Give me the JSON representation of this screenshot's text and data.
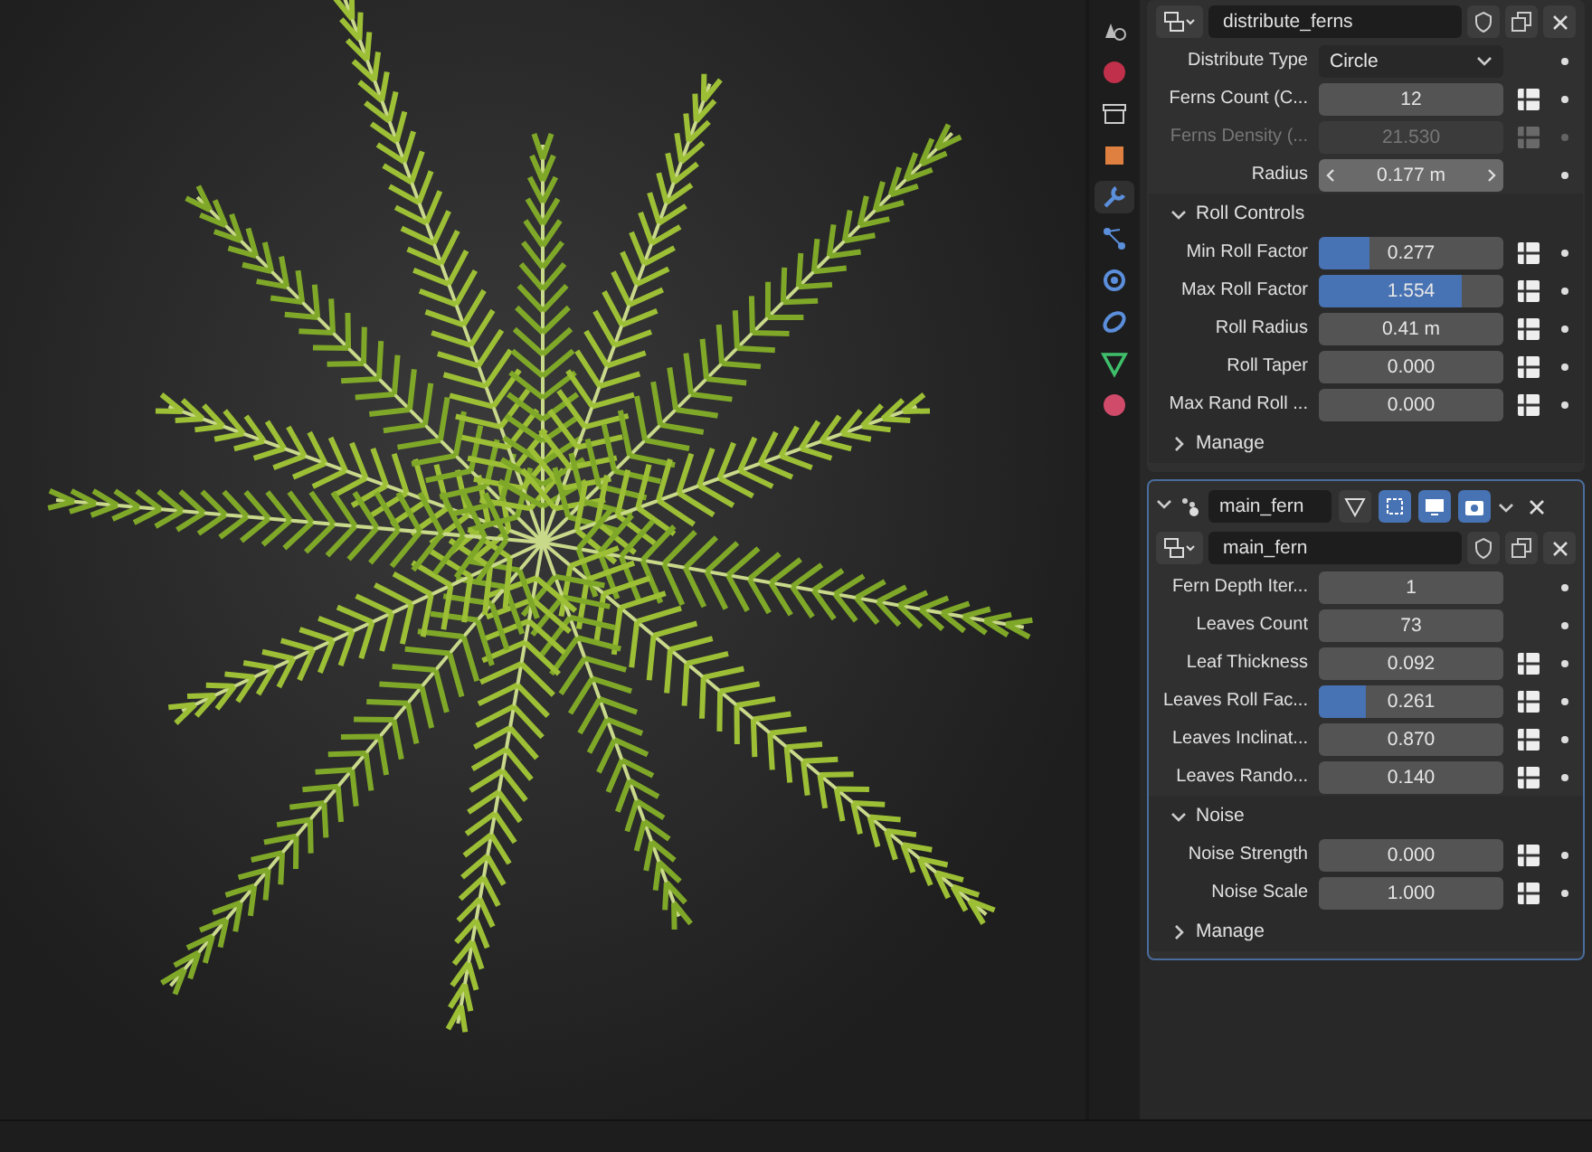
{
  "sidebar_tabs": [
    {
      "kind": "scene",
      "selected": false
    },
    {
      "kind": "world",
      "selected": false
    },
    {
      "kind": "collection",
      "selected": false
    },
    {
      "kind": "object",
      "selected": false
    },
    {
      "kind": "modifiers",
      "selected": true
    },
    {
      "kind": "particles",
      "selected": false
    },
    {
      "kind": "physics",
      "selected": false
    },
    {
      "kind": "constraints",
      "selected": false
    },
    {
      "kind": "data",
      "selected": false
    },
    {
      "kind": "material",
      "selected": false
    }
  ],
  "modifiers": [
    {
      "node_group": "distribute_ferns",
      "rows": [
        {
          "kind": "dropdown",
          "label": "Distribute Type",
          "value": "Circle",
          "decorator": false,
          "disabled": false
        },
        {
          "kind": "number",
          "label": "Ferns Count (C...",
          "value": "12",
          "decorator": true,
          "disabled": false
        },
        {
          "kind": "number",
          "label": "Ferns Density (...",
          "value": "21.530",
          "decorator": true,
          "disabled": true
        },
        {
          "kind": "arrows",
          "label": "Radius",
          "value": "0.177 m",
          "decorator": false,
          "disabled": false
        }
      ],
      "panels": [
        {
          "title": "Roll Controls",
          "expanded": true,
          "rows": [
            {
              "kind": "slider",
              "label": "Min Roll Factor",
              "value": "0.277",
              "level": 0.27,
              "decorator": true,
              "disabled": false
            },
            {
              "kind": "slider",
              "label": "Max Roll Factor",
              "value": "1.554",
              "level": 0.77,
              "decorator": true,
              "disabled": false
            },
            {
              "kind": "number",
              "label": "Roll Radius",
              "value": "0.41 m",
              "decorator": true,
              "disabled": false
            },
            {
              "kind": "number",
              "label": "Roll Taper",
              "value": "0.000",
              "decorator": true,
              "disabled": false
            },
            {
              "kind": "number",
              "label": "Max Rand Roll ...",
              "value": "0.000",
              "decorator": true,
              "disabled": false
            }
          ]
        },
        {
          "title": "Manage",
          "expanded": false
        }
      ]
    },
    {
      "header": {
        "name": "main_fern",
        "expanded": true,
        "toggles": [
          {
            "kind": "cage",
            "on": false
          },
          {
            "kind": "editmode",
            "on": true
          },
          {
            "kind": "viewport",
            "on": true
          },
          {
            "kind": "render",
            "on": true
          }
        ]
      },
      "node_group": "main_fern",
      "rows": [
        {
          "kind": "number",
          "label": "Fern Depth Iter...",
          "value": "1",
          "decorator": false,
          "disabled": false
        },
        {
          "kind": "number",
          "label": "Leaves Count",
          "value": "73",
          "decorator": false,
          "disabled": false
        },
        {
          "kind": "number",
          "label": "Leaf Thickness",
          "value": "0.092",
          "decorator": true,
          "disabled": false
        },
        {
          "kind": "slider",
          "label": "Leaves Roll Fac...",
          "value": "0.261",
          "level": 0.25,
          "decorator": true,
          "disabled": false
        },
        {
          "kind": "number",
          "label": "Leaves Inclinat...",
          "value": "0.870",
          "decorator": true,
          "disabled": false
        },
        {
          "kind": "number",
          "label": "Leaves Rando...",
          "value": "0.140",
          "decorator": true,
          "disabled": false
        }
      ],
      "panels": [
        {
          "title": "Noise",
          "expanded": true,
          "rows": [
            {
              "kind": "number",
              "label": "Noise Strength",
              "value": "0.000",
              "decorator": true,
              "disabled": false
            },
            {
              "kind": "number",
              "label": "Noise Scale",
              "value": "1.000",
              "decorator": true,
              "disabled": false
            }
          ]
        },
        {
          "title": "Manage",
          "expanded": false
        }
      ]
    }
  ]
}
